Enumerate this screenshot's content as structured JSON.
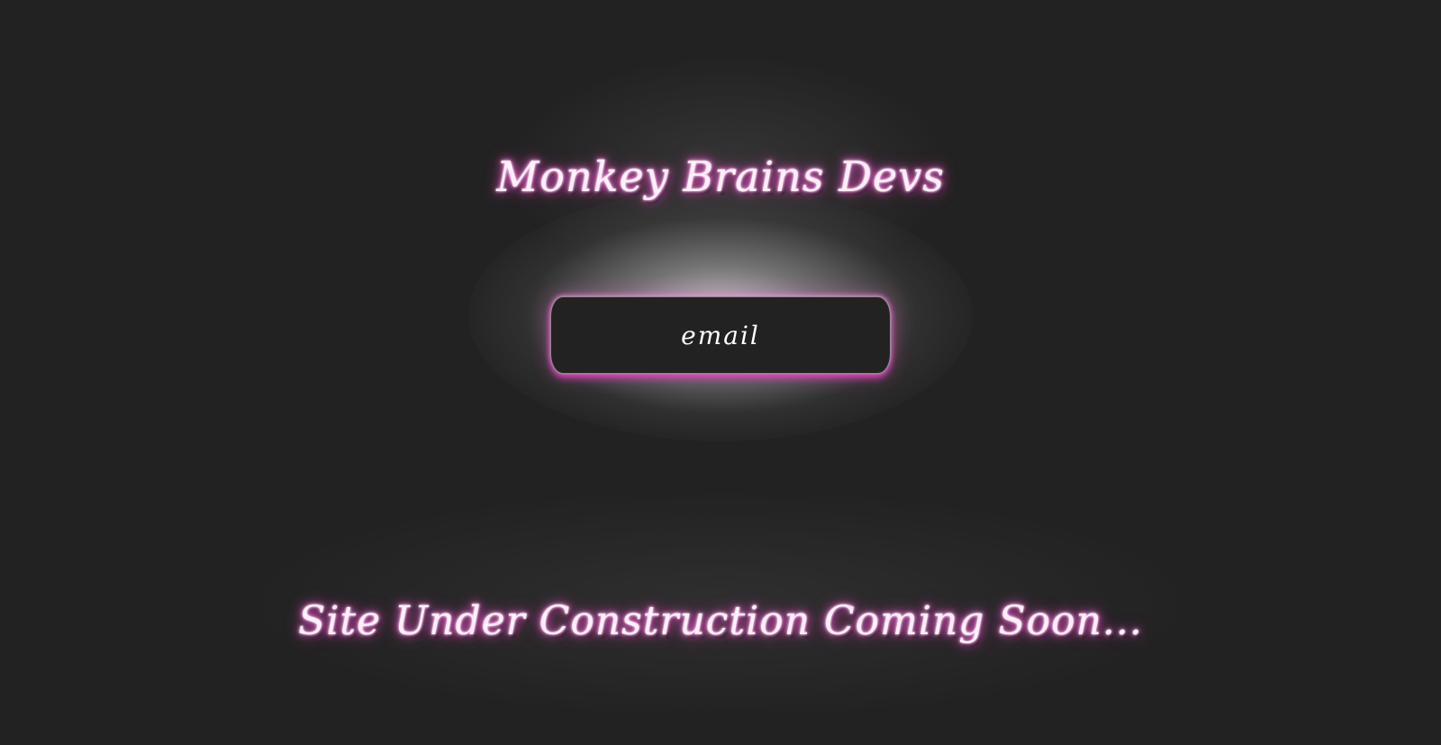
{
  "page": {
    "title": "Monkey Brains Devs",
    "footer_text": "Site Under Construction Coming Soon..."
  },
  "signup": {
    "email_placeholder": "email",
    "email_value": ""
  },
  "colors": {
    "background": "#222222",
    "neon_text": "#fff0fa",
    "neon_glow": "#ff5fd6",
    "input_background": "#222222"
  }
}
